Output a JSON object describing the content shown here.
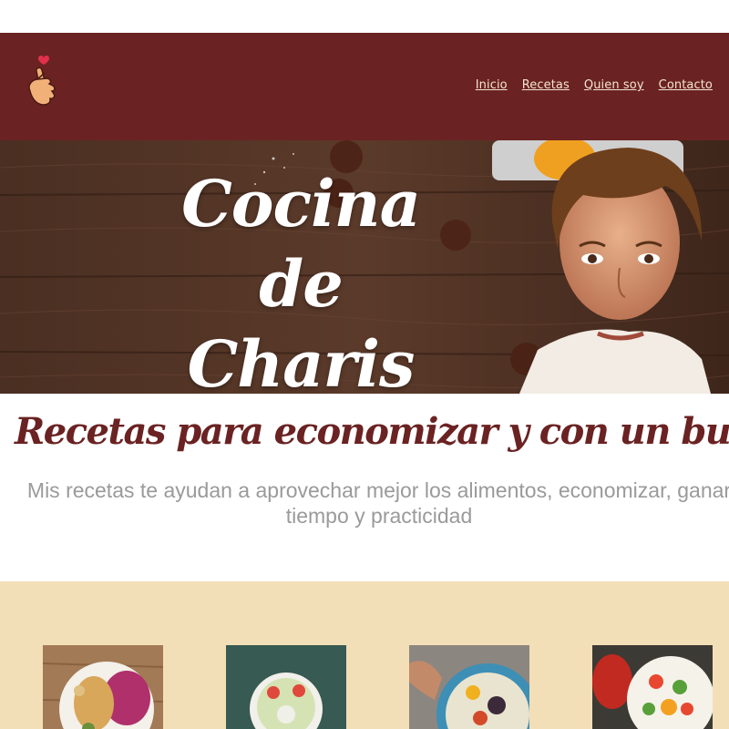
{
  "header": {
    "logo_icon": "finger-heart-icon",
    "nav": [
      {
        "label": "Inicio"
      },
      {
        "label": "Recetas"
      },
      {
        "label": "Quien soy"
      },
      {
        "label": "Contacto"
      }
    ]
  },
  "hero": {
    "title_line1": "Cocina de",
    "title_line2": "Charis"
  },
  "intro": {
    "tagline": "Recetas para economizar y con un buen gusto",
    "subtitle_line1": "Mis recetas te ayudan a aprovechar mejor los alimentos, economizar, ganar",
    "subtitle_line2": "tiempo y practicidad"
  },
  "colors": {
    "brand": "#6b2222",
    "nav_text": "#f3e6cf",
    "recipes_bg": "#f3dfb7",
    "subtitle": "#9a9a9a"
  }
}
